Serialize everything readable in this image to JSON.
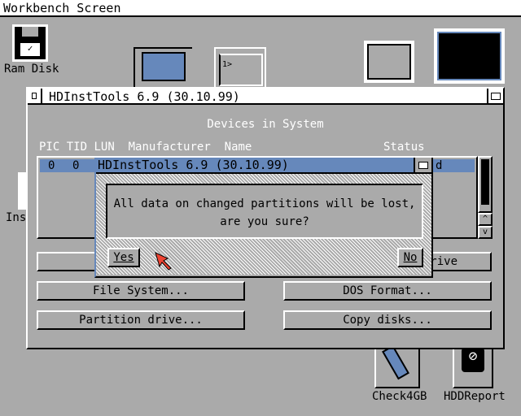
{
  "screen": {
    "title": "Workbench Screen"
  },
  "icons": [
    {
      "label": "Ram Disk"
    },
    {
      "label": "Ins"
    },
    {
      "label": "Check4GB"
    },
    {
      "label": "HDDReport"
    }
  ],
  "window": {
    "title": "HDInstTools 6.9 (30.10.99)",
    "heading": "Devices in System",
    "columns": [
      "PIC",
      "TID",
      "LUN",
      "Manufacturer",
      "Name",
      "Status"
    ],
    "rows": [
      {
        "pic": "0",
        "tid": "0",
        "status_partial": "d"
      }
    ],
    "buttons": {
      "row1_right_partial": "rive",
      "file_system": "File System...",
      "dos_format": "DOS Format...",
      "partition_drive": "Partition drive...",
      "copy_disks": "Copy disks..."
    }
  },
  "requester": {
    "title": "HDInstTools 6.9 (30.10.99)",
    "message_line1": "All data on changed partitions will be lost,",
    "message_line2": "are you sure?",
    "yes": "Yes",
    "no": "No"
  },
  "colors": {
    "background": "#aaaaaa",
    "highlight": "#ffffff",
    "shadow": "#000000",
    "selection": "#6688bb"
  }
}
